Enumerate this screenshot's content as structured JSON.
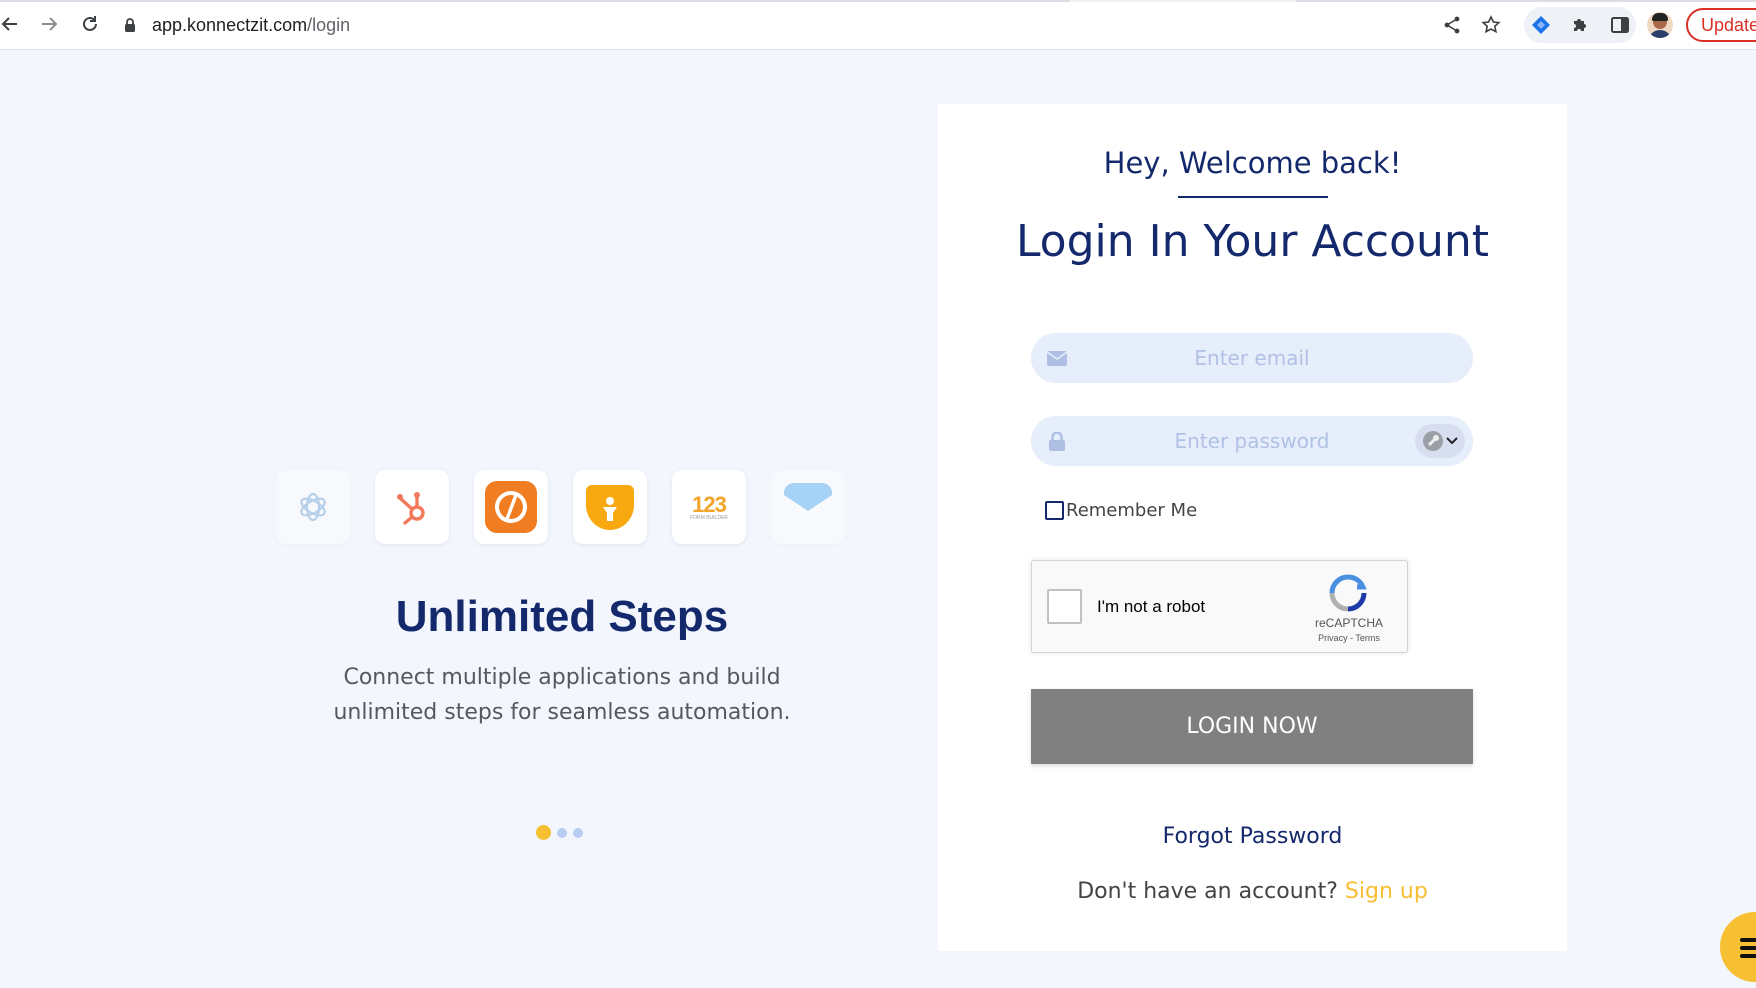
{
  "browser": {
    "url_domain": "app.konnectzit.com",
    "url_path": "/login",
    "update_label": "Update",
    "icons": [
      "back-icon",
      "forward-icon",
      "reload-icon",
      "lock-icon",
      "share-icon",
      "star-icon",
      "extension-diamond-icon",
      "puzzle-icon",
      "side-panel-icon",
      "profile-avatar"
    ]
  },
  "promo": {
    "app_icons": [
      "openai-icon",
      "hubspot-icon",
      "pipedrive-like-icon",
      "funnel-icon",
      "123formbuilder-icon",
      "mail-icon"
    ],
    "icon_text_123": "123",
    "icon_sub_123": "FORM BUILDER",
    "title": "Unlimited Steps",
    "description_line1": "Connect multiple applications and build",
    "description_line2": "unlimited steps for seamless automation.",
    "carousel_active_index": 0,
    "carousel_count": 3
  },
  "login": {
    "welcome": "Hey, Welcome back!",
    "heading": "Login In Your Account",
    "email_placeholder": "Enter email",
    "password_placeholder": "Enter password",
    "remember_label": "Remember Me",
    "recaptcha": {
      "label": "I'm not a robot",
      "brand": "reCAPTCHA",
      "privacy": "Privacy",
      "separator": " - ",
      "terms": "Terms"
    },
    "login_button": "LOGIN NOW",
    "forgot_password": "Forgot Password",
    "no_account_text": "Don't have an account? ",
    "signup_link": "Sign up"
  },
  "colors": {
    "navy": "#14296c",
    "accent_yellow": "#f7bf32",
    "page_bg": "#f3f7fd",
    "field_bg": "#e6eefc",
    "button_gray": "#808080"
  }
}
